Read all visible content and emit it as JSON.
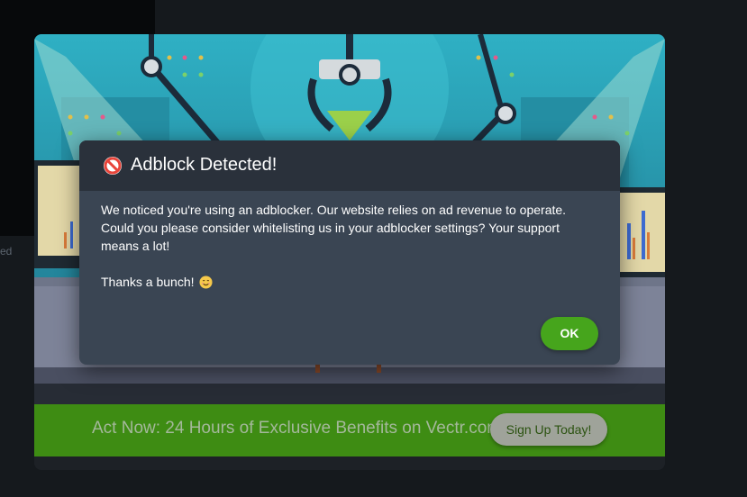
{
  "background": {
    "side_text": "ed"
  },
  "modal": {
    "title": "Adblock Detected!",
    "title_icon": "no-entry-icon",
    "message": "We noticed you're using an adblocker. Our website relies on ad revenue to operate. Could you please consider whitelisting us in your adblocker settings? Your support means a lot!",
    "thanks": "Thanks a bunch!",
    "thanks_icon": "smiling-face-icon",
    "ok_label": "OK",
    "colors": {
      "header": "#2a313b",
      "body": "#3a4553",
      "ok_button": "#46a51c"
    }
  },
  "promo": {
    "banner_text": "Act Now: 24 Hours of Exclusive Benefits on Vectr.com!",
    "cta_label": "Sign Up Today!",
    "colors": {
      "banner": "#3e8c13",
      "cta": "#9fa39a"
    }
  }
}
